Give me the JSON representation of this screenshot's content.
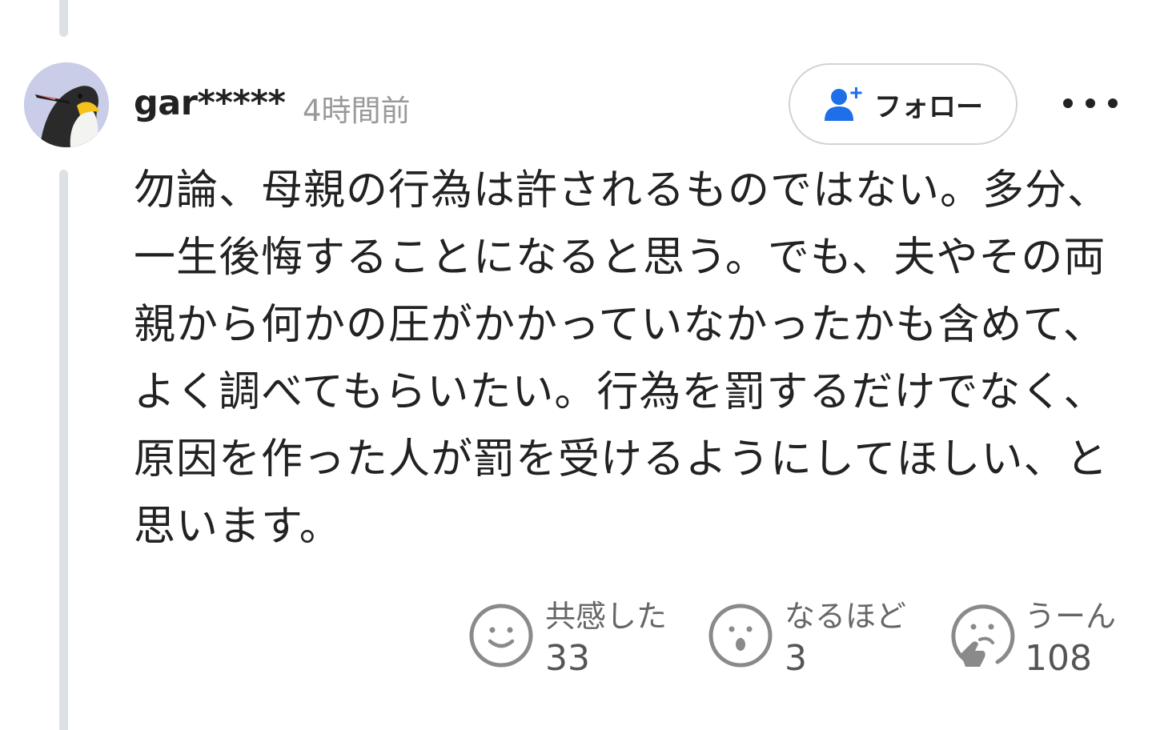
{
  "comment": {
    "username": "gar*****",
    "timestamp": "4時間前",
    "follow_label": "フォロー",
    "body": "勿論、母親の行為は許されるものではない。多分、一生後悔することになると思う。でも、夫やその両親から何かの圧がかかっていなかったかも含めて、よく調べてもらいたい。行為を罰するだけでなく、原因を作った人が罰を受けるようにしてほしい、と思います。"
  },
  "reactions": [
    {
      "icon": "smile-icon",
      "label": "共感した",
      "count": "33"
    },
    {
      "icon": "surprised-face-icon",
      "label": "なるほど",
      "count": "3"
    },
    {
      "icon": "thinking-face-icon",
      "label": "うーん",
      "count": "108"
    }
  ],
  "colors": {
    "accent_blue": "#1e6fe8",
    "thread_line": "#dde1e6",
    "muted_text": "#999999"
  }
}
